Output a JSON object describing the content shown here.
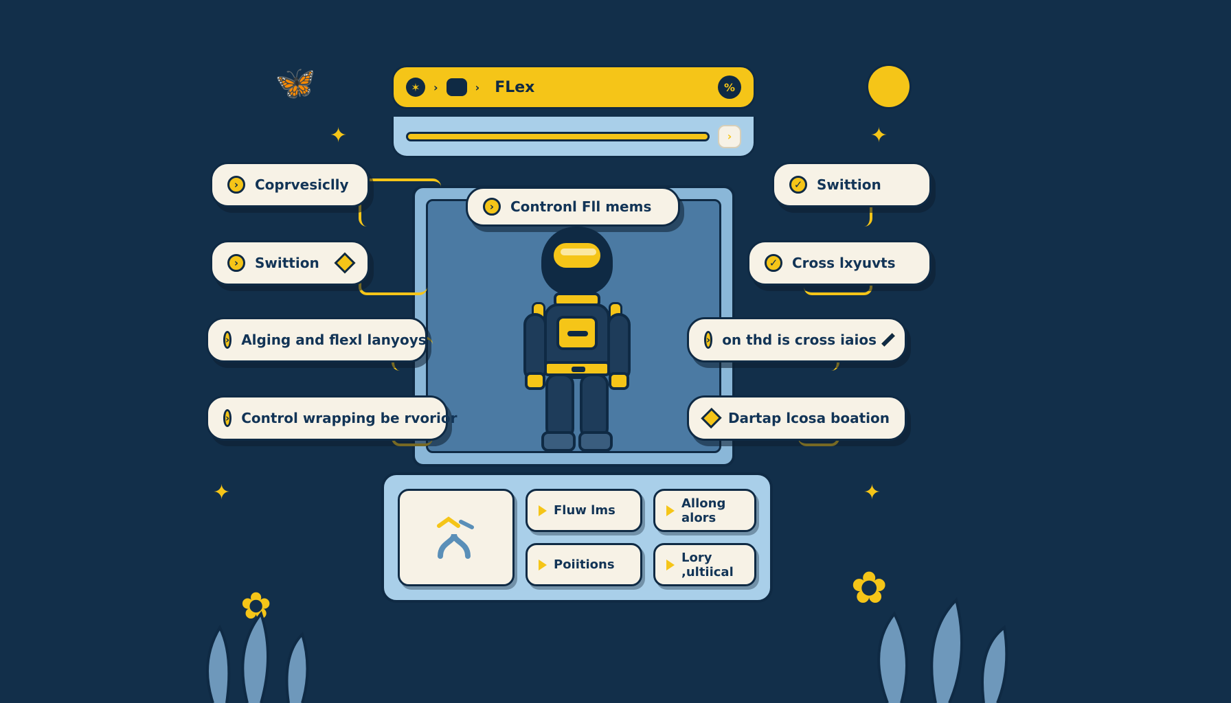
{
  "titlebar": {
    "title": "FLex"
  },
  "center_pill": {
    "label": "Contronl Fll mems"
  },
  "left_pills": [
    {
      "label": "Coprvesiclly"
    },
    {
      "label": "Swittion"
    },
    {
      "label": "Alging and flexl lanyoys"
    },
    {
      "label": "Control wrapping be rvorior"
    }
  ],
  "right_pills": [
    {
      "label": "Swittion"
    },
    {
      "label": "Cross lxyuvts"
    },
    {
      "label": "on thd is cross iaios"
    },
    {
      "label": "Dartap lcosa boation"
    }
  ],
  "dock": {
    "buttons": [
      {
        "label": "Fluw lms"
      },
      {
        "label": "Allong alors"
      },
      {
        "label": "Poiitions"
      },
      {
        "label": "Lory ,ultiical"
      }
    ]
  },
  "colors": {
    "bg": "#122f4a",
    "accent": "#f5c518",
    "cream": "#f7f2e6",
    "ink": "#0f2a44",
    "sky": "#a9cfe9"
  }
}
